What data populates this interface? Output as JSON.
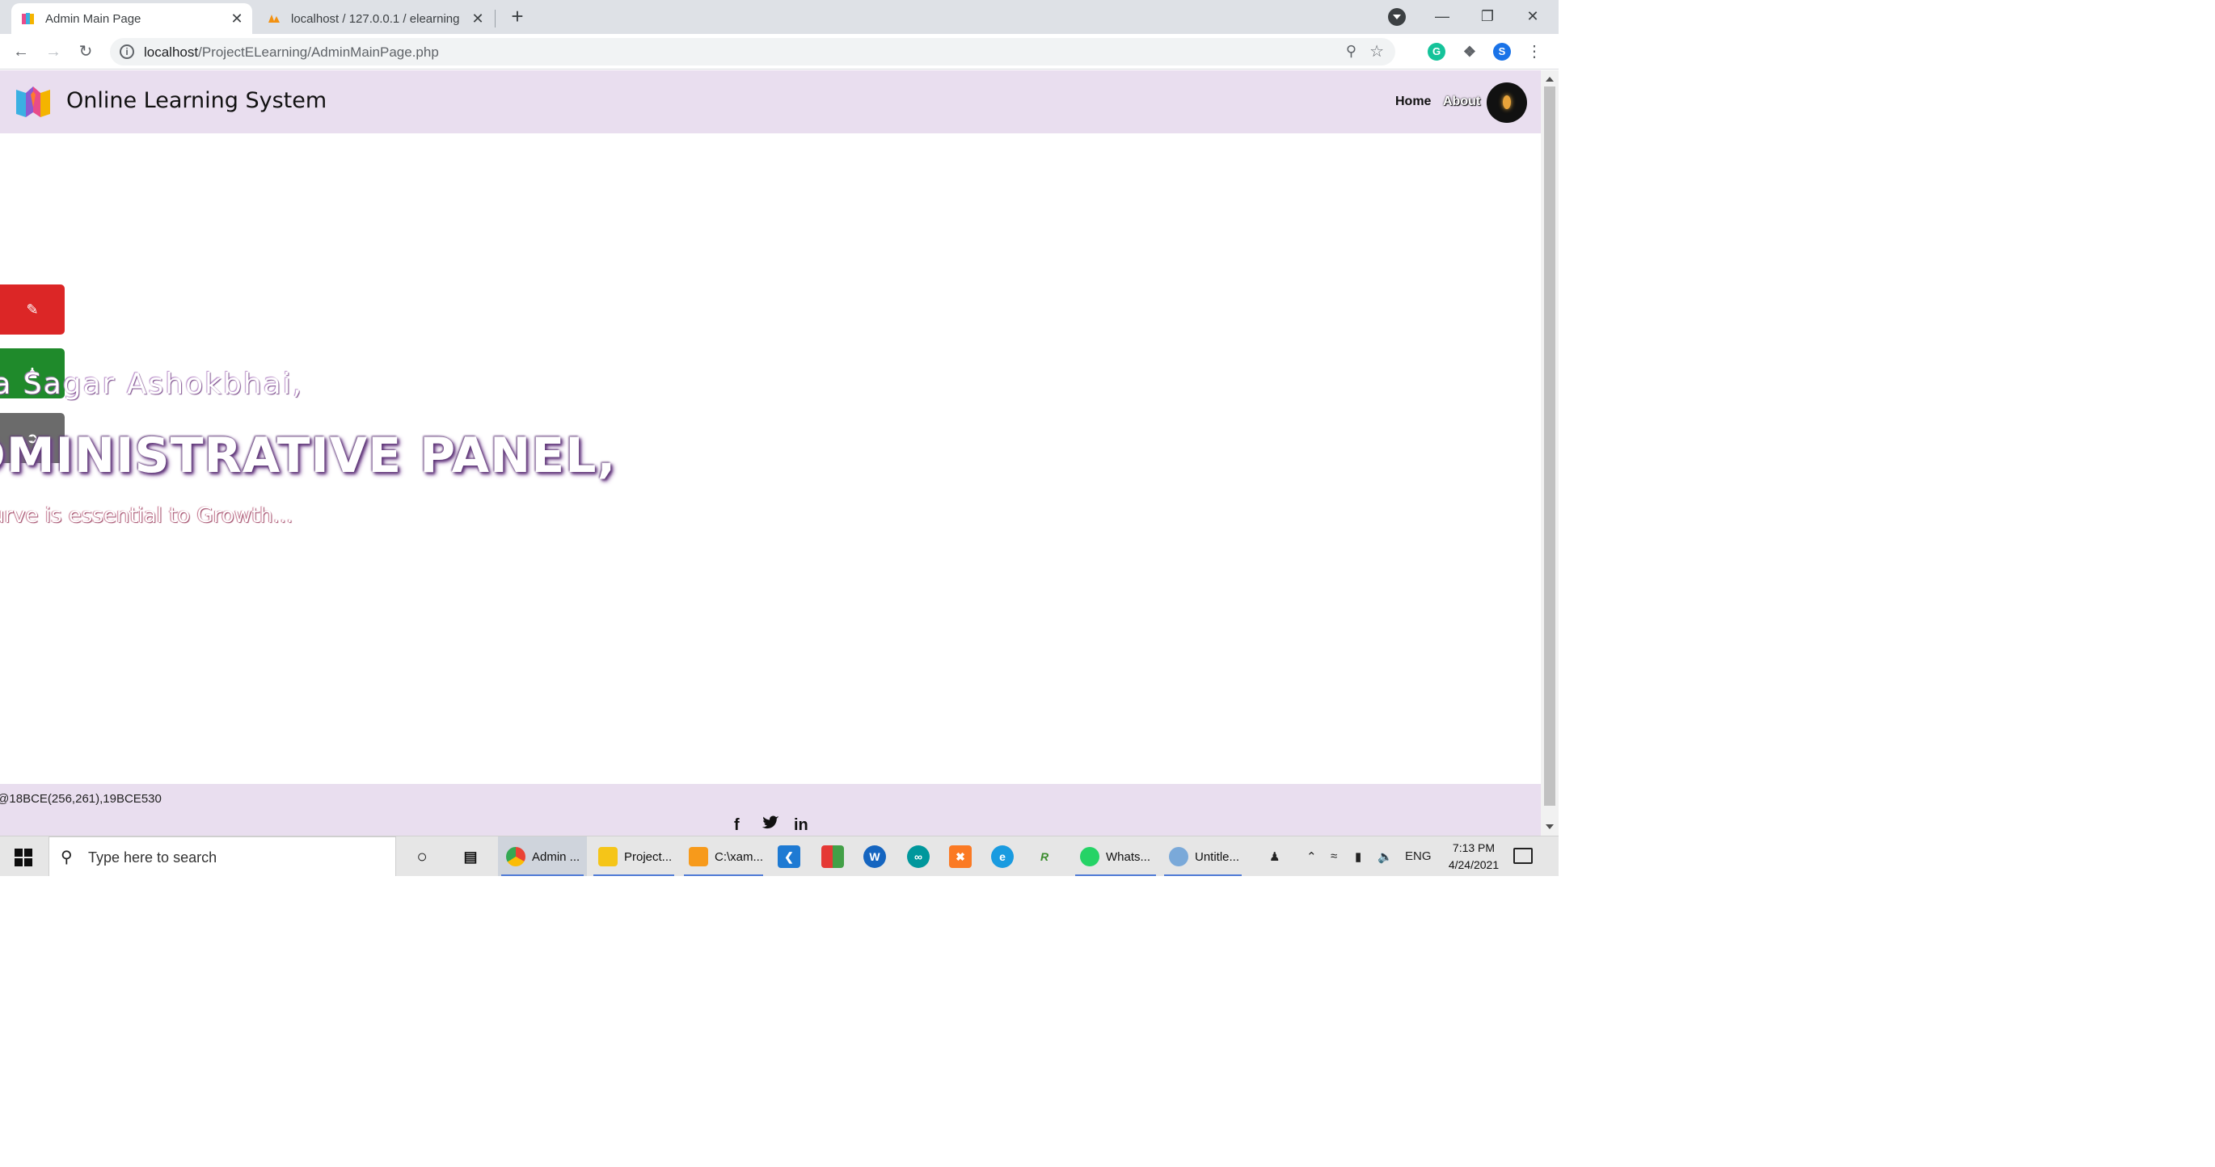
{
  "browser": {
    "tabs": [
      {
        "title": "Admin Main Page",
        "active": true
      },
      {
        "title": "localhost / 127.0.0.1 / elearning",
        "active": false
      }
    ],
    "close_glyph": "✕",
    "new_tab_glyph": "+",
    "address": {
      "host": "localhost",
      "path": "/ProjectELearning/AdminMainPage.php"
    },
    "profile_initial": "S"
  },
  "site": {
    "brand": "Online Learning System",
    "nav": {
      "home": "Home",
      "about": "About"
    },
    "greeting": "Hi Vasoya Sagar Ashokbhai,",
    "welcome": "WELCOME TO ADMINISTRATIVE PANEL,",
    "tagline": "A Learning Curve is essential to Growth...",
    "footer": "@18BCE(256,261),19BCE530",
    "social": {
      "facebook": "f",
      "linkedin": "in"
    },
    "side_buttons": [
      {
        "name": "edit",
        "color": "#dc2626",
        "icon": "pencil-icon"
      },
      {
        "name": "profile",
        "color": "#1f8a2b",
        "icon": "user-icon"
      },
      {
        "name": "logout",
        "color": "#6b6b6b",
        "icon": "logout-icon"
      }
    ],
    "accent": "#e9deef"
  },
  "taskbar": {
    "search_placeholder": "Type here to search",
    "apps": [
      {
        "label": "Admin ...",
        "active": true
      },
      {
        "label": "Project...",
        "active": false
      },
      {
        "label": "C:\\xam...",
        "active": false
      },
      {
        "label": "Whats...",
        "active": false
      },
      {
        "label": "Untitle...",
        "active": false
      }
    ],
    "language": "ENG",
    "time": "7:13 PM",
    "date": "4/24/2021"
  }
}
